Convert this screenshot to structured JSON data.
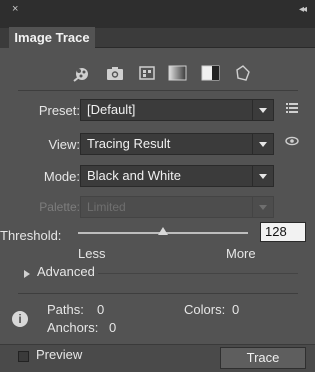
{
  "window": {
    "close_glyph": "×",
    "collapse_glyph": "◂◂",
    "tab_title": "Image Trace"
  },
  "presets_icons": [
    "auto-color-icon",
    "high-color-icon",
    "low-color-icon",
    "grayscale-icon",
    "black-and-white-icon",
    "outline-icon"
  ],
  "fields": {
    "preset": {
      "label": "Preset:",
      "value": "[Default]"
    },
    "view": {
      "label": "View:",
      "value": "Tracing Result"
    },
    "mode": {
      "label": "Mode:",
      "value": "Black and White"
    },
    "palette": {
      "label": "Palette:",
      "value": "Limited"
    }
  },
  "threshold": {
    "label": "Threshold:",
    "value": "128",
    "min_label": "Less",
    "max_label": "More",
    "level_fraction": 0.5
  },
  "advanced": {
    "label": "Advanced"
  },
  "stats": {
    "paths_label": "Paths:",
    "paths_value": "0",
    "anchors_label": "Anchors:",
    "anchors_value": "0",
    "colors_label": "Colors:",
    "colors_value": "0"
  },
  "footer": {
    "preview_label": "Preview",
    "trace_label": "Trace"
  },
  "colors": {
    "panel_bg": "#535353",
    "titlebar_bg": "#2e2e2e",
    "field_bg": "#3b3b3b",
    "text": "#e6e6e6"
  }
}
